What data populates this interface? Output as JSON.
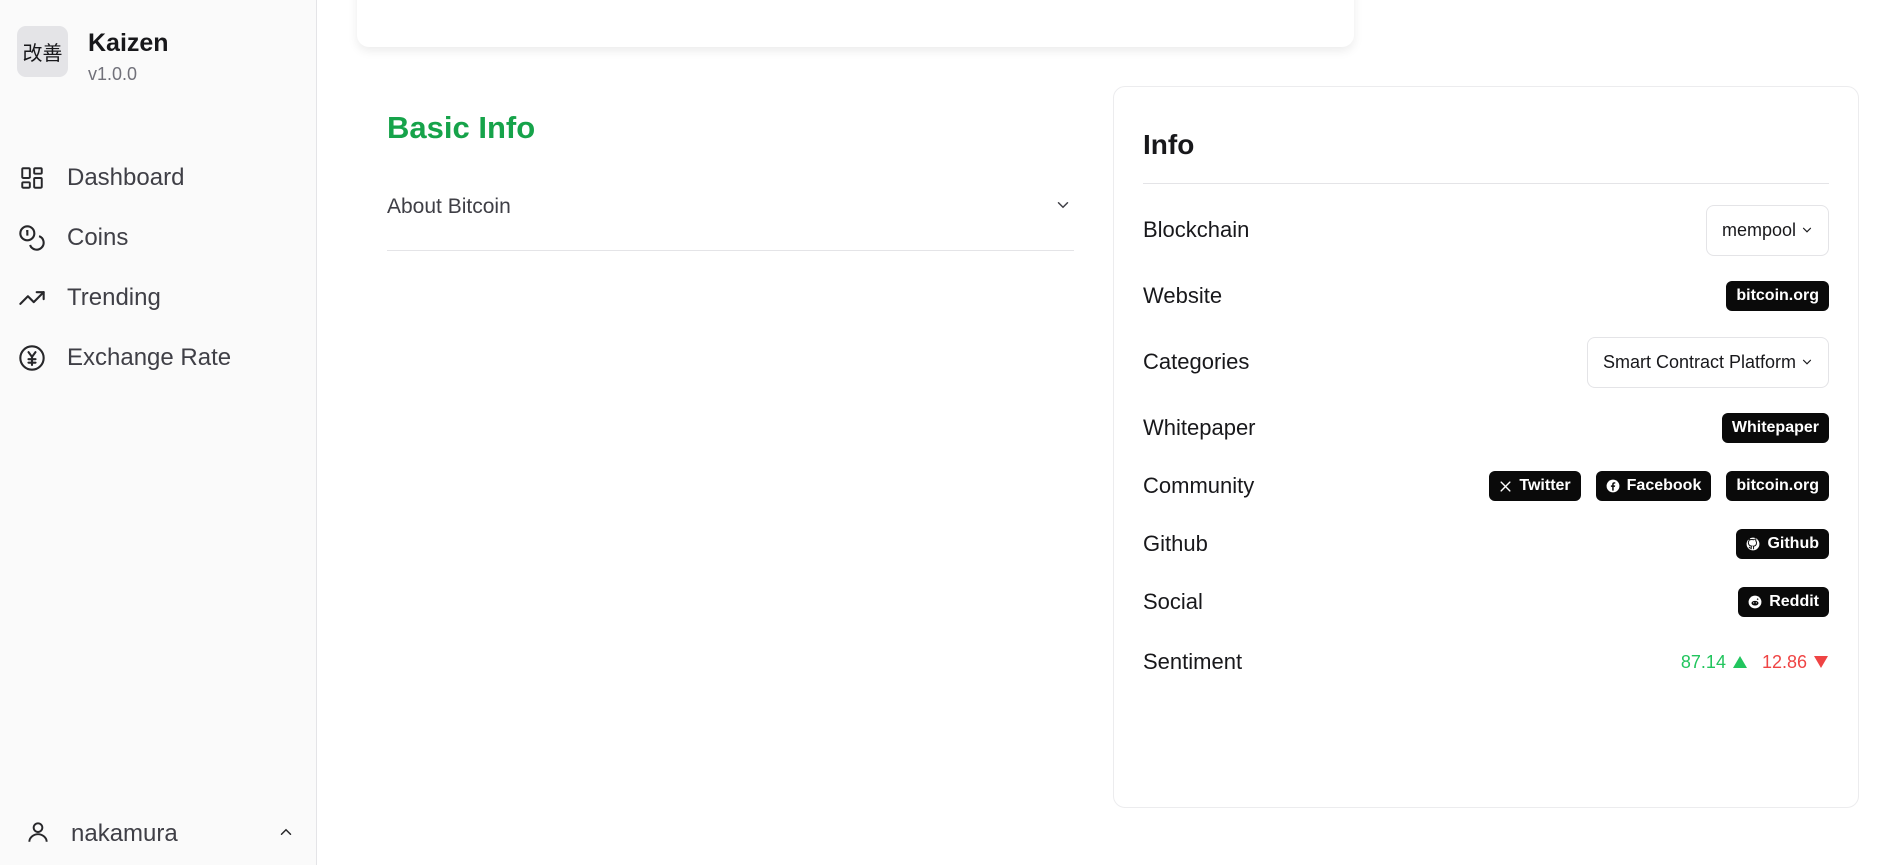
{
  "sidebar": {
    "brand": {
      "logo_text": "改善",
      "name": "Kaizen",
      "version": "v1.0.0"
    },
    "items": [
      {
        "label": "Dashboard",
        "icon": "dashboard-icon"
      },
      {
        "label": "Coins",
        "icon": "coins-icon"
      },
      {
        "label": "Trending",
        "icon": "trending-icon"
      },
      {
        "label": "Exchange Rate",
        "icon": "exchange-rate-icon"
      }
    ],
    "user": {
      "name": "nakamura",
      "icon": "user-icon",
      "toggle_icon": "chevron-up-icon"
    }
  },
  "main": {
    "basic_info": {
      "title": "Basic Info",
      "accordion_label": "About Bitcoin"
    },
    "info": {
      "title": "Info",
      "blockchain": {
        "label": "Blockchain",
        "value": "mempool"
      },
      "website": {
        "label": "Website",
        "link": "bitcoin.org"
      },
      "categories": {
        "label": "Categories",
        "value": "Smart Contract Platform"
      },
      "whitepaper": {
        "label": "Whitepaper",
        "link": "Whitepaper"
      },
      "community": {
        "label": "Community",
        "links": [
          "Twitter",
          "Facebook",
          "bitcoin.org"
        ]
      },
      "github": {
        "label": "Github",
        "link": "Github"
      },
      "social": {
        "label": "Social",
        "link": "Reddit"
      },
      "sentiment": {
        "label": "Sentiment",
        "up": "87.14",
        "down": "12.86"
      }
    }
  },
  "colors": {
    "accent": "#16a34a",
    "positive": "#22c55e",
    "negative": "#ef4444",
    "pill_bg": "#0a0a0a"
  }
}
